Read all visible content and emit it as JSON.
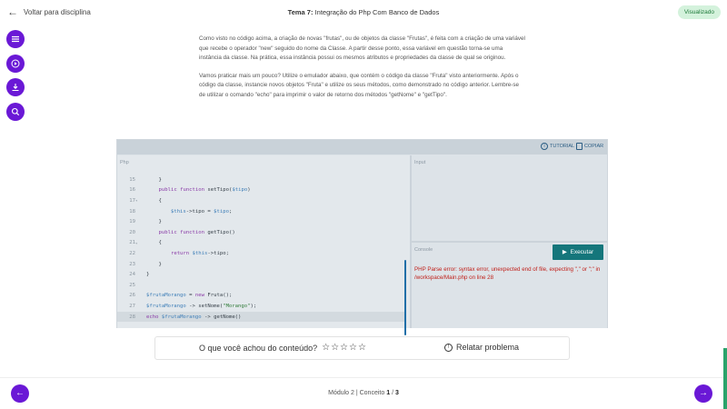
{
  "header": {
    "back_label": "Voltar para disciplina",
    "title_prefix": "Tema 7:",
    "title_text": "Integração do Php Com Banco de Dados",
    "status_badge": "Visualizado"
  },
  "sidebar": {
    "buttons": [
      {
        "name": "menu-button",
        "icon": "menu-icon"
      },
      {
        "name": "play-button",
        "icon": "play-circle-icon"
      },
      {
        "name": "download-button",
        "icon": "download-icon"
      },
      {
        "name": "search-button",
        "icon": "search-icon"
      }
    ]
  },
  "article": {
    "paragraph1": "Como visto no código acima, a criação de novas \"frutas\", ou de objetos da classe \"Frutas\", é feita com a criação de uma variável que recebe o operador \"new\" seguido do nome da Classe. A partir desse ponto, essa variável em questão torna-se uma instância da classe. Na prática, essa instância possui os mesmos atributos e propriedades da classe de qual se originou.",
    "paragraph2": "Vamos praticar mais um pouco? Utilize o emulador abaixo, que contém o código da classe \"Fruta\" visto anteriormente. Após o código da classe, instancie novos objetos \"Fruta\" e utilize os seus métodos, como demonstrado no código anterior. Lembre-se de utilizar o comando \"echo\" para imprimir o valor de retorno dos métodos \"getNome\" e \"getTipo\"."
  },
  "editor": {
    "tutorial_label": "TUTORIAL",
    "copy_label": "COPIAR",
    "language_label": "Php",
    "input_label": "Input",
    "console_label": "Console",
    "run_label": "Executar",
    "console_output": "PHP Parse error: syntax error, unexpected end of file, expecting \",\" or \";\" in /workspace/Main.php on line 28",
    "lines": [
      {
        "n": "15",
        "fold": "",
        "code": "    }"
      },
      {
        "n": "16",
        "fold": "",
        "code": "    public function setTipo($tipo)"
      },
      {
        "n": "17",
        "fold": "▾",
        "code": "    {"
      },
      {
        "n": "18",
        "fold": "",
        "code": "        $this->tipo = $tipo;"
      },
      {
        "n": "19",
        "fold": "",
        "code": "    }"
      },
      {
        "n": "20",
        "fold": "",
        "code": "    public function getTipo()"
      },
      {
        "n": "21",
        "fold": "▾",
        "code": "    {"
      },
      {
        "n": "22",
        "fold": "",
        "code": "        return $this->tipo;"
      },
      {
        "n": "23",
        "fold": "",
        "code": "    }"
      },
      {
        "n": "24",
        "fold": "",
        "code": "}"
      },
      {
        "n": "25",
        "fold": "",
        "code": ""
      },
      {
        "n": "26",
        "fold": "",
        "code": "$frutaMorango = new Fruta();"
      },
      {
        "n": "27",
        "fold": "",
        "code": "$frutaMorango -> setNome(\"Morango\");"
      },
      {
        "n": "28",
        "fold": "",
        "code": "echo $frutaMorango -> getNome()"
      }
    ],
    "active_line": "28"
  },
  "feedback": {
    "question": "O que você achou do conteúdo?",
    "stars": 5,
    "report_label": "Relatar problema"
  },
  "footer": {
    "module_text": "Módulo 2 | Conceito",
    "current": "1",
    "separator": "/",
    "total": "3"
  },
  "colors": {
    "accent": "#6a18d6",
    "run_button": "#15767b",
    "error_text": "#c0201a",
    "badge_bg": "#d4f2dc"
  }
}
